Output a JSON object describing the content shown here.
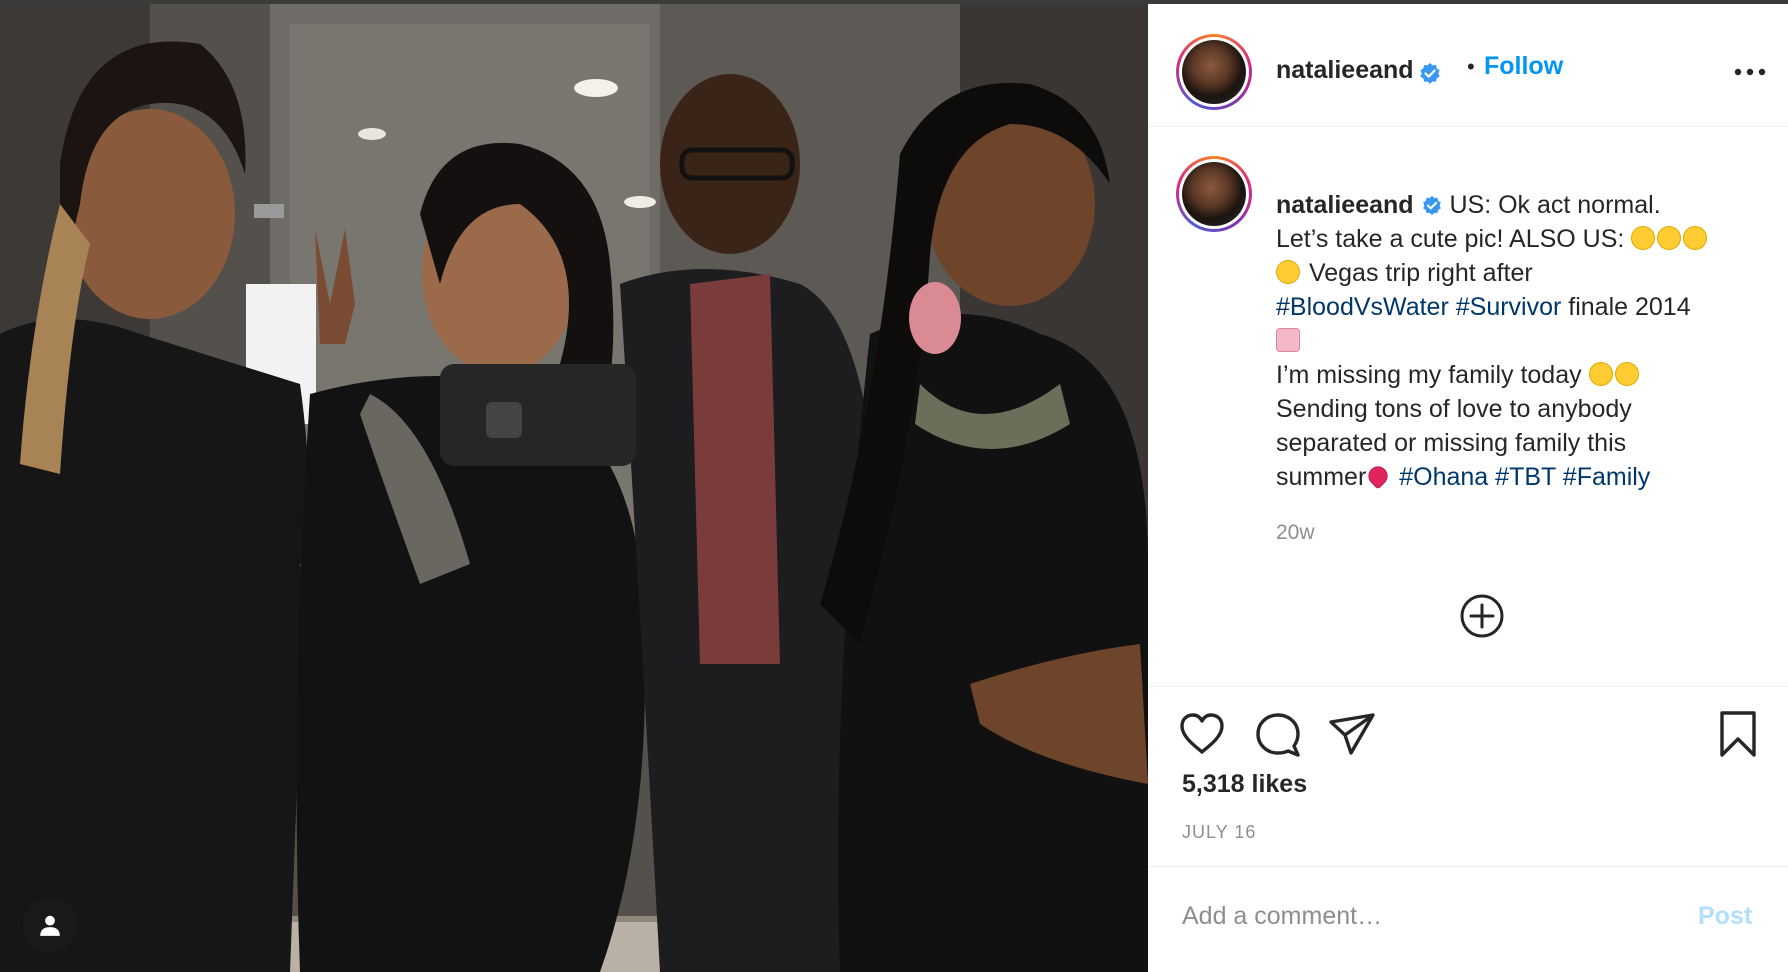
{
  "post": {
    "username": "natalieeand",
    "follow_label": "Follow",
    "separator": "•",
    "caption": {
      "line1": "US: Ok act normal.",
      "line2": "Let’s take a cute pic! ALSO US:",
      "line3": "Vegas trip right after",
      "hashtag_blood": "#BloodVsWater",
      "hashtag_survivor": "#Survivor",
      "line4_tail": "finale 2014",
      "line5": "I’m missing my family today",
      "line6": "Sending tons of love to anybody",
      "line7": "separated or missing family this",
      "line8": "summer",
      "hashtag_ohana": "#Ohana",
      "hashtag_tbt": "#TBT",
      "hashtag_family": "#Family"
    },
    "time_ago": "20w",
    "likes": "5,318 likes",
    "date": "JULY 16",
    "comment_placeholder": "Add a comment…",
    "post_label": "Post"
  },
  "icons": {
    "verified": "verified-badge-icon",
    "more": "more-options-icon",
    "plus": "load-more-comments-icon",
    "like": "heart-icon",
    "comment": "comment-icon",
    "share": "paper-plane-icon",
    "save": "bookmark-icon",
    "user_tag": "user-tag-icon"
  },
  "colors": {
    "link": "#0095f6",
    "hashtag": "#00376b",
    "text": "#262626",
    "muted": "#8e8e8e",
    "post_disabled": "#b2dffc"
  }
}
